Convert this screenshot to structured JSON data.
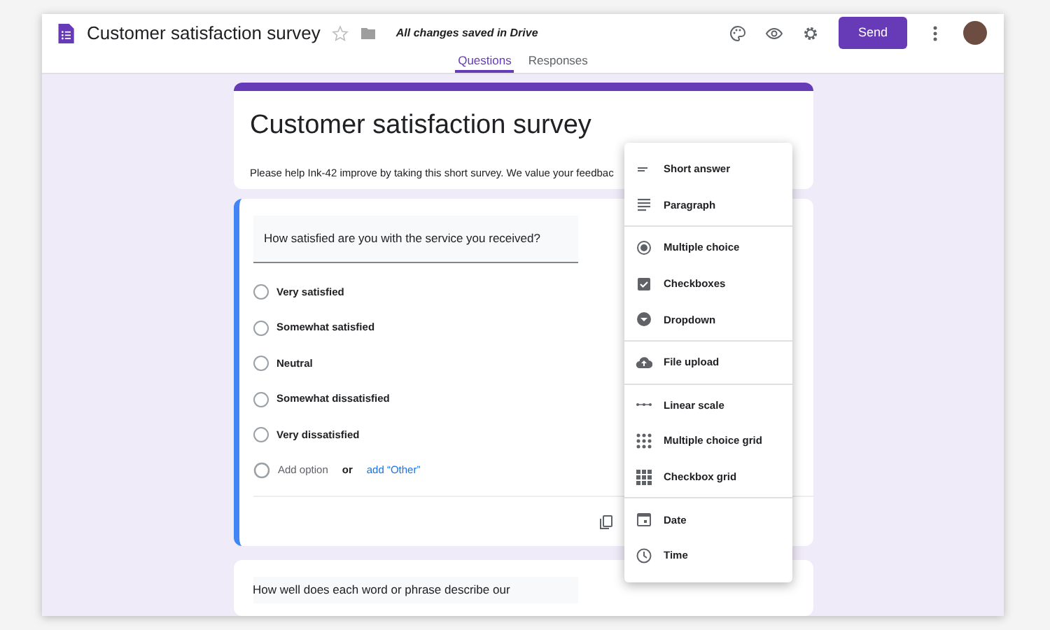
{
  "header": {
    "title": "Customer satisfaction survey",
    "starred": false,
    "save_status": "All changes saved in Drive",
    "send_button": "Send"
  },
  "tabs": [
    {
      "label": "Questions",
      "selected": true
    },
    {
      "label": "Responses",
      "selected": false
    }
  ],
  "form_header": {
    "title": "Customer satisfaction survey",
    "description": "Please help Ink-42 improve by taking this short survey. We value your feedbac"
  },
  "question": {
    "text": "How satisfied are you with the service you received?",
    "options": [
      {
        "label": "Very satisfied",
        "selected": false
      },
      {
        "label": "Somewhat satisfied",
        "selected": false
      },
      {
        "label": "Neutral",
        "selected": false
      },
      {
        "label": "Somewhat dissatisfied",
        "selected": false
      },
      {
        "label": "Very dissatisfied",
        "selected": false
      }
    ],
    "add_option": "Add option",
    "or": "or",
    "add_other": "add “Other”"
  },
  "next_question": {
    "text": "How well does each word or phrase describe our"
  },
  "type_menu": {
    "sections": [
      [
        "Short answer",
        "Paragraph"
      ],
      [
        "Multiple choice",
        "Checkboxes",
        "Dropdown"
      ],
      [
        "File upload"
      ],
      [
        "Linear scale",
        "Multiple choice grid",
        "Checkbox grid"
      ],
      [
        "Date",
        "Time"
      ]
    ]
  }
}
